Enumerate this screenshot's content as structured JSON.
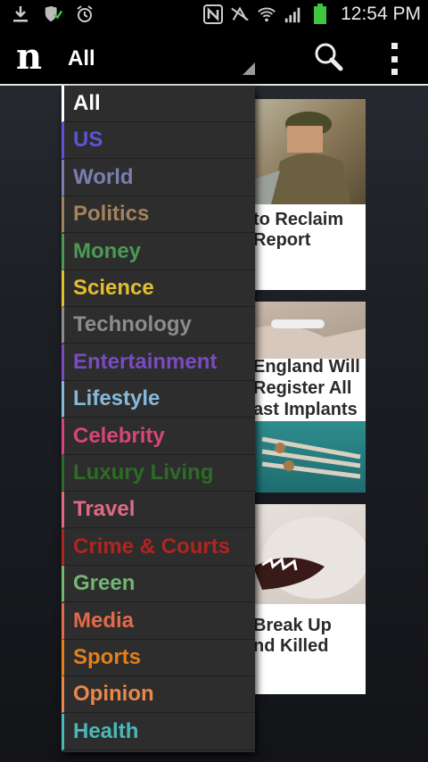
{
  "status_bar": {
    "time": "12:54 PM",
    "left_icons": [
      "download-icon",
      "shield-update-icon",
      "alarm-icon"
    ],
    "right_icons": [
      "nfc-icon",
      "mute-icon",
      "wifi-icon",
      "signal-icon",
      "battery-icon"
    ]
  },
  "action_bar": {
    "logo": "n",
    "selected_section": "All",
    "search_icon": "search-icon",
    "overflow_icon": "overflow-menu-icon"
  },
  "articles": [
    {
      "headline_line1": "to Reclaim",
      "headline_line2": "Report"
    },
    {
      "headline_line1": "England Will",
      "headline_line2": "Register All",
      "headline_line3": "ast Implants"
    },
    {
      "headline_line1": "Break Up",
      "headline_line2": "nd Killed"
    }
  ],
  "sections": [
    {
      "label": "All",
      "color": "#ffffff"
    },
    {
      "label": "US",
      "color": "#5b55d6"
    },
    {
      "label": "World",
      "color": "#7a7fb0"
    },
    {
      "label": "Politics",
      "color": "#a3835e"
    },
    {
      "label": "Money",
      "color": "#4a9a56"
    },
    {
      "label": "Science",
      "color": "#e1c02c"
    },
    {
      "label": "Technology",
      "color": "#8c8c8c"
    },
    {
      "label": "Entertainment",
      "color": "#7a4bbf"
    },
    {
      "label": "Lifestyle",
      "color": "#86b8d8"
    },
    {
      "label": "Celebrity",
      "color": "#d8457a"
    },
    {
      "label": "Luxury Living",
      "color": "#2e6b26"
    },
    {
      "label": "Travel",
      "color": "#e06a86"
    },
    {
      "label": "Crime & Courts",
      "color": "#b0251f"
    },
    {
      "label": "Green",
      "color": "#72b672"
    },
    {
      "label": "Media",
      "color": "#e36a4a"
    },
    {
      "label": "Sports",
      "color": "#e47f1c"
    },
    {
      "label": "Opinion",
      "color": "#e8884a"
    },
    {
      "label": "Health",
      "color": "#4ab8b8"
    }
  ]
}
